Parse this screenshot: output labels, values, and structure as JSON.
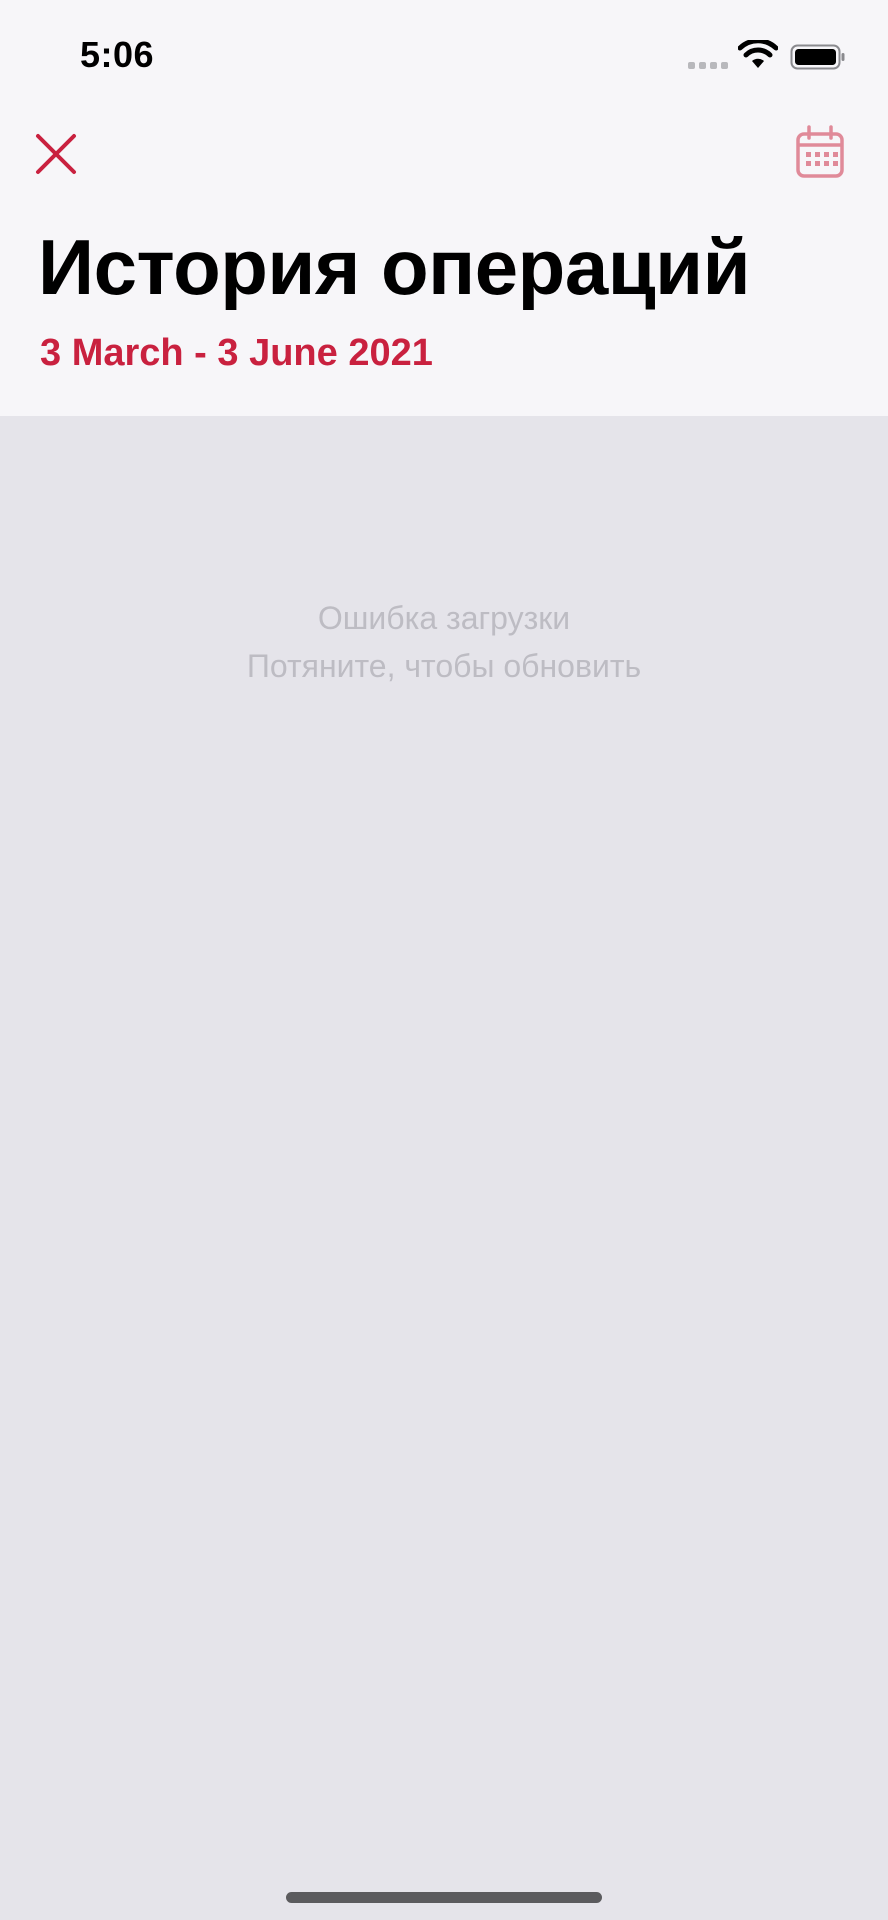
{
  "status_bar": {
    "time": "5:06",
    "icons": [
      "signal-dots-icon",
      "wifi-icon",
      "battery-icon"
    ]
  },
  "nav": {
    "close_icon": "close-icon",
    "calendar_icon": "calendar-icon"
  },
  "header": {
    "title": "История операций",
    "date_range": "3 March - 3 June 2021"
  },
  "empty_state": {
    "line1": "Ошибка загрузки",
    "line2": "Потяните, чтобы обновить"
  },
  "colors": {
    "accent": "#c9213f",
    "accent_light": "#e08a99",
    "header_bg": "#f7f6f9",
    "content_bg": "#e5e4ea",
    "muted_text": "#bdbcc3"
  }
}
